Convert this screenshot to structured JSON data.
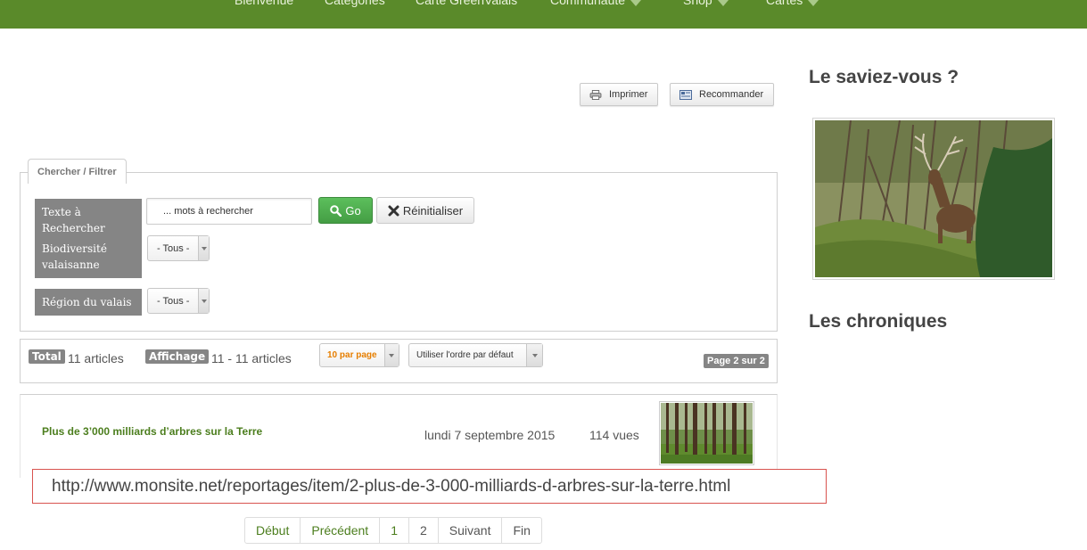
{
  "nav": {
    "items": [
      {
        "label": "Bienvenue",
        "dropdown": false
      },
      {
        "label": "Catégories",
        "dropdown": false
      },
      {
        "label": "Carte GreenValais",
        "dropdown": false
      },
      {
        "label": "Communauté",
        "dropdown": true
      },
      {
        "label": "Shop",
        "dropdown": true
      },
      {
        "label": "Cartes",
        "dropdown": true
      }
    ]
  },
  "actions": {
    "print_label": "Imprimer",
    "recommend_label": "Recommander"
  },
  "filter": {
    "legend": "Chercher / Filtrer",
    "text_label": "Texte à Rechercher",
    "search_placeholder": "... mots à rechercher",
    "go_label": "Go",
    "reset_label": "Réinitialiser",
    "biodiversity_label": "Biodiversité valaisanne",
    "biodiversity_value": "- Tous -",
    "region_label": "Région du valais",
    "region_value": "- Tous -"
  },
  "stats": {
    "total_badge": "Total",
    "total_text": "11 articles",
    "display_badge": "Affichage",
    "display_text": "11 - 11 articles",
    "per_page": "10 par page",
    "order": "Utiliser l'ordre par défaut",
    "page_info": "Page 2 sur 2"
  },
  "article": {
    "title": "Plus de 3’000 milliards d’arbres sur la Terre",
    "date": "lundi 7 septembre 2015",
    "views": "114 vues"
  },
  "url_tooltip": "http://www.monsite.net/reportages/item/2-plus-de-3-000-milliards-d-arbres-sur-la-terre.html",
  "pagination": {
    "first": "Début",
    "prev": "Précédent",
    "page1": "1",
    "page2": "2",
    "next": "Suivant",
    "last": "Fin"
  },
  "sidebar": {
    "did_you_know": "Le saviez-vous ?",
    "chronicles": "Les chroniques"
  },
  "colors": {
    "nav_green": "#5a8a2a",
    "link_green": "#4c7e1e",
    "go_green": "#4cae4c",
    "label_grey": "#858585",
    "url_border": "#d9534f"
  }
}
